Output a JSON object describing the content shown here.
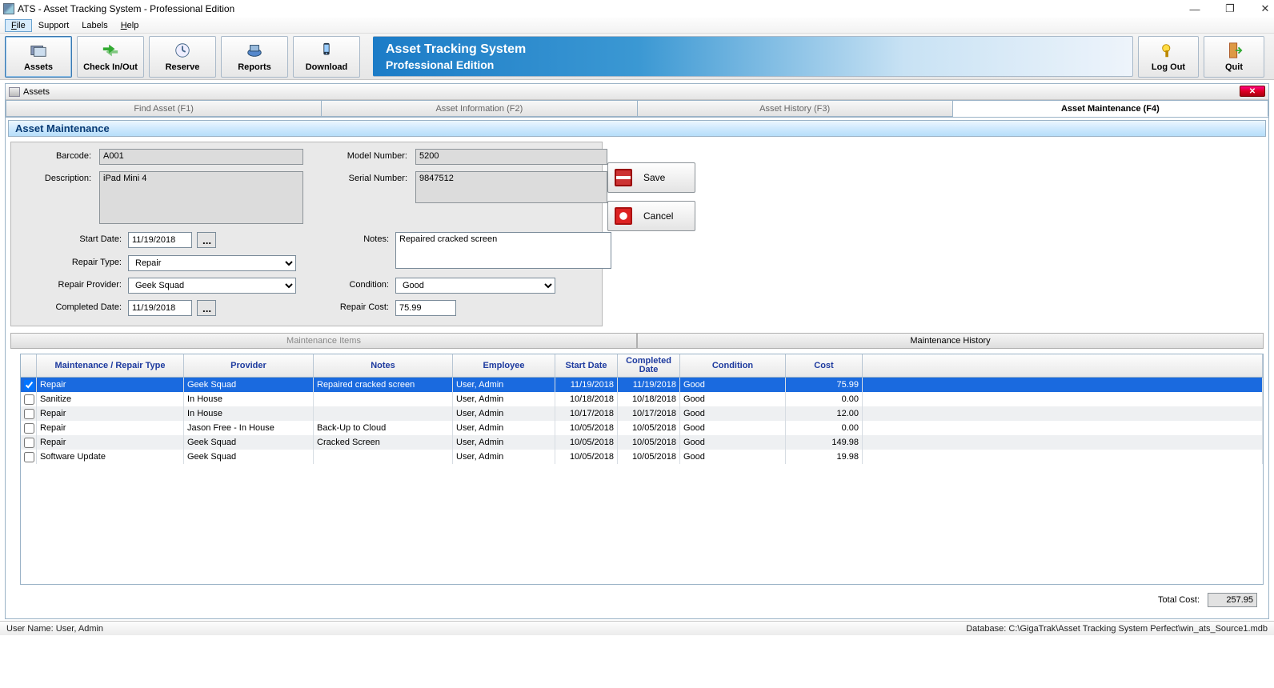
{
  "window": {
    "title": "ATS - Asset Tracking System - Professional Edition"
  },
  "menu": {
    "file": "File",
    "support": "Support",
    "labels": "Labels",
    "help": "Help"
  },
  "toolbar": {
    "assets": "Assets",
    "checkinout": "Check In/Out",
    "reserve": "Reserve",
    "reports": "Reports",
    "download": "Download",
    "banner_line1": "Asset Tracking System",
    "banner_line2": "Professional Edition",
    "logout": "Log Out",
    "quit": "Quit"
  },
  "subwindow": {
    "title": "Assets"
  },
  "tabs": {
    "find": "Find Asset (F1)",
    "info": "Asset Information (F2)",
    "history": "Asset History (F3)",
    "maint": "Asset Maintenance (F4)"
  },
  "section": {
    "title": "Asset Maintenance"
  },
  "form": {
    "labels": {
      "barcode": "Barcode:",
      "description": "Description:",
      "model": "Model Number:",
      "serial": "Serial Number:",
      "start": "Start Date:",
      "repair_type": "Repair Type:",
      "repair_provider": "Repair Provider:",
      "completed": "Completed Date:",
      "notes": "Notes:",
      "condition": "Condition:",
      "repair_cost": "Repair Cost:"
    },
    "values": {
      "barcode": "A001",
      "description": "iPad Mini 4",
      "model": "5200",
      "serial": "9847512",
      "start_date": "11/19/2018",
      "repair_type": "Repair",
      "repair_provider": "Geek Squad",
      "completed_date": "11/19/2018",
      "notes": "Repaired cracked screen",
      "condition": "Good",
      "repair_cost": "75.99"
    }
  },
  "buttons": {
    "save": "Save",
    "cancel": "Cancel"
  },
  "lowertabs": {
    "items": "Maintenance Items",
    "history": "Maintenance History"
  },
  "table": {
    "headers": {
      "type": "Maintenance / Repair Type",
      "provider": "Provider",
      "notes": "Notes",
      "employee": "Employee",
      "start": "Start Date",
      "completed_l1": "Completed",
      "completed_l2": "Date",
      "condition": "Condition",
      "cost": "Cost"
    },
    "rows": [
      {
        "type": "Repair",
        "provider": "Geek Squad",
        "notes": "Repaired cracked screen",
        "employee": "User, Admin",
        "start": "11/19/2018",
        "completed": "11/19/2018",
        "condition": "Good",
        "cost": "75.99"
      },
      {
        "type": "Sanitize",
        "provider": "In House",
        "notes": "",
        "employee": "User, Admin",
        "start": "10/18/2018",
        "completed": "10/18/2018",
        "condition": "Good",
        "cost": "0.00"
      },
      {
        "type": "Repair",
        "provider": "In House",
        "notes": "",
        "employee": "User, Admin",
        "start": "10/17/2018",
        "completed": "10/17/2018",
        "condition": "Good",
        "cost": "12.00"
      },
      {
        "type": "Repair",
        "provider": "Jason Free - In House",
        "notes": "Back-Up to Cloud",
        "employee": "User, Admin",
        "start": "10/05/2018",
        "completed": "10/05/2018",
        "condition": "Good",
        "cost": "0.00"
      },
      {
        "type": "Repair",
        "provider": "Geek Squad",
        "notes": "Cracked Screen",
        "employee": "User, Admin",
        "start": "10/05/2018",
        "completed": "10/05/2018",
        "condition": "Good",
        "cost": "149.98"
      },
      {
        "type": "Software Update",
        "provider": "Geek Squad",
        "notes": "",
        "employee": "User, Admin",
        "start": "10/05/2018",
        "completed": "10/05/2018",
        "condition": "Good",
        "cost": "19.98"
      }
    ]
  },
  "totals": {
    "label": "Total Cost:",
    "value": "257.95"
  },
  "status": {
    "username_label": "User Name:  ",
    "username": "User, Admin",
    "db_label": "Database:  ",
    "db_path": "C:\\GigaTrak\\Asset Tracking System Perfect\\win_ats_Source1.mdb"
  }
}
